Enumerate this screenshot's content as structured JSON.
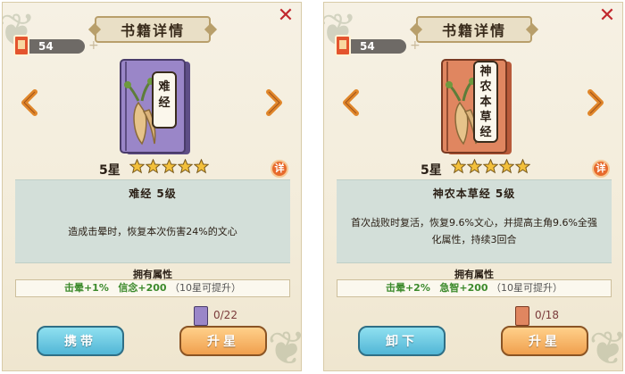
{
  "panels": [
    {
      "title": "书籍详情",
      "resource_count": "54",
      "book_name_vertical": [
        "难",
        "经"
      ],
      "cover_color": "#9a86c8",
      "star_label": "5星",
      "star_count": 5,
      "info_icon_text": "详",
      "desc_title": "难经  5级",
      "desc_text": "造成击晕时，恢复本次伤害24%的文心",
      "attr_title": "拥有属性",
      "attr_1": "击晕+1%",
      "attr_2": "信念+200",
      "attr_note": "（10星可提升）",
      "fragment_text": "0/22",
      "fragment_color": "#9a86c8",
      "primary_button": "携带",
      "secondary_button": "升星"
    },
    {
      "title": "书籍详情",
      "resource_count": "54",
      "book_name_vertical": [
        "神",
        "农",
        "本",
        "草",
        "经"
      ],
      "cover_color": "#e08660",
      "star_label": "5星",
      "star_count": 5,
      "info_icon_text": "详",
      "desc_title": "神农本草经  5级",
      "desc_text": "首次战败时复活，恢复9.6%文心，并提高主角9.6%全强化属性，持续3回合",
      "attr_title": "拥有属性",
      "attr_1": "击晕+2%",
      "attr_2": "急智+200",
      "attr_note": "（10星可提升）",
      "fragment_text": "0/18",
      "fragment_color": "#e08660",
      "primary_button": "卸下",
      "secondary_button": "升星"
    }
  ],
  "icons": {
    "close": "close-icon",
    "prev": "arrow-left-icon",
    "next": "arrow-right-icon",
    "star": "star-icon"
  },
  "colors": {
    "arrow": "#e0862a",
    "star_fill": "#f3c03b",
    "close": "#c1272d"
  }
}
